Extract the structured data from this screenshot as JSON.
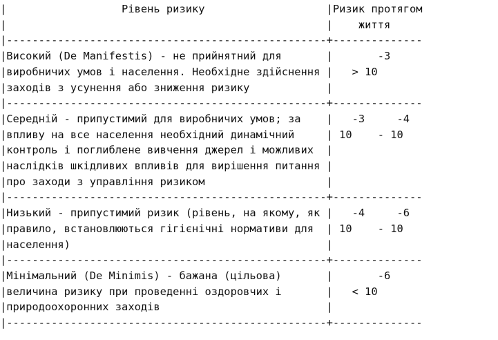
{
  "lines": [
    "|                  Рівень ризику                   |Ризик протягом",
    "|                                                  |    життя",
    "|--------------------------------------------------+--------------",
    "|Високий (De Manifestis) - не прийнятний для       |       -3",
    "|виробничих умов і населення. Необхідне здійснення |   > 10",
    "|заходів з усунення або зниження ризику            |",
    "|--------------------------------------------------+--------------",
    "|Середній - припустимий для виробничих умов; за    |   -3     -4",
    "|впливу на все населення необхідний динамічний     | 10    - 10",
    "|контроль і поглиблене вивчення джерел і можливих  |",
    "|наслідків шкідливих впливів для вирішення питання |",
    "|про заходи з управління ризиком                   |",
    "|--------------------------------------------------+--------------",
    "|Низький - припустимий ризик (рівень, на якому, як |   -4     -6",
    "|правило, встановлюються гігієнічні нормативи для  | 10    - 10",
    "|населення)                                        |",
    "|--------------------------------------------------+--------------",
    "|Мінімальний (De Minimis) - бажана (цільова)       |       -6",
    "|величина ризику при проведенні оздоровчих і       |   < 10",
    "|природоохоронних заходів                          |",
    "|--------------------------------------------------+--------------"
  ]
}
